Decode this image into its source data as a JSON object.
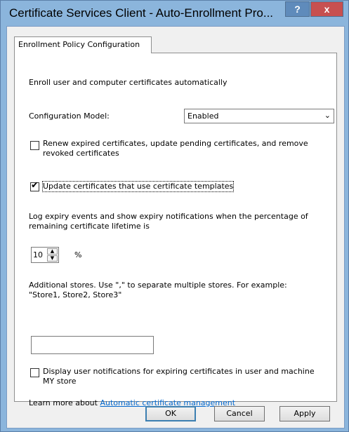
{
  "window": {
    "title": "Certificate Services Client - Auto-Enrollment Pro...",
    "help_label": "?",
    "close_label": "x"
  },
  "tab": {
    "label": "Enrollment Policy Configuration"
  },
  "panel": {
    "heading": "Enroll user and computer certificates automatically",
    "config_model": {
      "label": "Configuration Model:",
      "value": "Enabled"
    },
    "renew_checkbox": {
      "label_line1": "Renew expired certificates, update pending certificates, and remove",
      "label_line2": "revoked certificates",
      "checked": false
    },
    "update_checkbox": {
      "label": "Update certificates that use certificate templates",
      "checked": true
    },
    "expiry": {
      "line1": "Log expiry events and show expiry notifications when the percentage of",
      "line2": "remaining certificate lifetime is",
      "value": "10",
      "unit": "%"
    },
    "stores": {
      "line1": "Additional stores. Use \",\" to separate multiple stores. For example:",
      "line2": "\"Store1, Store2, Store3\"",
      "value": ""
    },
    "notify_checkbox": {
      "label_line1": "Display user notifications for expiring certificates in user and machine",
      "label_line2": "MY store",
      "checked": false
    },
    "learn_more": {
      "text": "Learn more about ",
      "link": "Automatic certificate management"
    }
  },
  "buttons": {
    "ok": "OK",
    "cancel": "Cancel",
    "apply": "Apply"
  }
}
